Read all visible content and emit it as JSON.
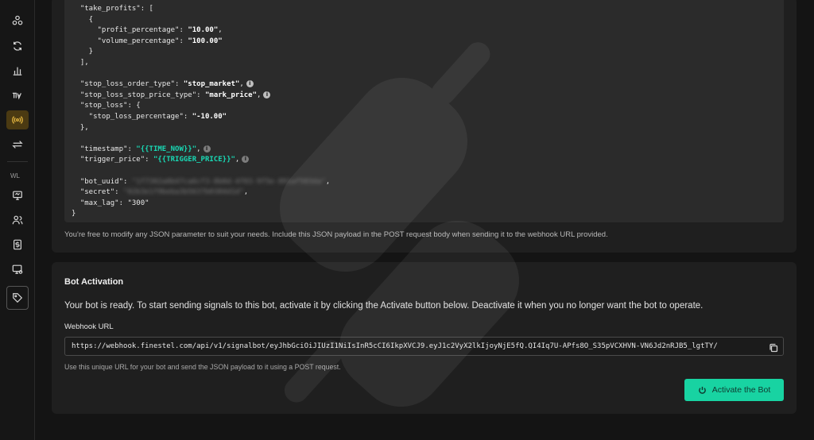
{
  "sidebar": {
    "items": [
      {
        "icon": "nodes-icon"
      },
      {
        "icon": "refresh-icon"
      },
      {
        "icon": "bar-chart-icon"
      },
      {
        "icon": "tradingview-icon"
      },
      {
        "icon": "signal-bot-icon",
        "active": true
      },
      {
        "icon": "swap-icon"
      },
      {
        "icon": "monitor-icon"
      },
      {
        "icon": "users-icon"
      },
      {
        "icon": "dollar-icon"
      },
      {
        "icon": "screen-settings-icon"
      },
      {
        "icon": "tag-icon"
      }
    ],
    "section_label": "WL"
  },
  "payload": {
    "lines": {
      "l1": "  \"take_profits\": [",
      "l2": "    {",
      "l3a": "      \"profit_percentage\": ",
      "l3b": "\"10.00\"",
      "l3c": ",",
      "l4a": "      \"volume_percentage\": ",
      "l4b": "\"100.00\"",
      "l5": "    }",
      "l6": "  ],",
      "l7a": "  \"stop_loss_order_type\": ",
      "l7b": "\"stop_market\"",
      "l7c": ",",
      "l8a": "  \"stop_loss_stop_price_type\": ",
      "l8b": "\"mark_price\"",
      "l8c": ",",
      "l9": "  \"stop_loss\": {",
      "l10a": "    \"stop_loss_percentage\": ",
      "l10b": "\"-10.00\"",
      "l11": "  },",
      "l12a": "  \"timestamp\": ",
      "l12b": "\"{{TIME_NOW}}\"",
      "l12c": ",",
      "l13a": "  \"trigger_price\": ",
      "l13b": "\"{{TRIGGER_PRICE}}\"",
      "l13c": ",",
      "l14a": "  \"bot_uuid\": ",
      "l14b": "\"1f7302a0b47ca6cf3-8b0d-4f03-9f5e-891af583da\"",
      "l14c": ",",
      "l15a": "  \"secret\": ",
      "l15b": "\"02b3e1f9beba3b5637b0384d1d\"",
      "l15c": ",",
      "l16a": "  \"max_lag\": ",
      "l16b": "\"300\"",
      "l17": "}"
    },
    "note": "You're free to modify any JSON parameter to suit your needs. Include this JSON payload in the POST request body when sending it to the webhook URL provided."
  },
  "activation": {
    "title": "Bot Activation",
    "description": "Your bot is ready. To start sending signals to this bot, activate it by clicking the Activate button below. Deactivate it when you no longer want the bot to operate.",
    "webhook_label": "Webhook URL",
    "webhook_url": "https://webhook.finestel.com/api/v1/signalbot/eyJhbGciOiJIUzI1NiIsInR5cCI6IkpXVCJ9.eyJ1c2VyX2lkIjoyNjE5fQ.QI4Iq7U-APfs8O_S35pVCXHVN-VN6Jd2nRJB5_lgtTY/",
    "webhook_note": "Use this unique URL for your bot and send the JSON payload to it using a POST request.",
    "activate_label": "Activate the Bot"
  },
  "colors": {
    "accent": "#18d3a2",
    "active_nav": "#e7b840",
    "template_var": "#19d9b5"
  }
}
